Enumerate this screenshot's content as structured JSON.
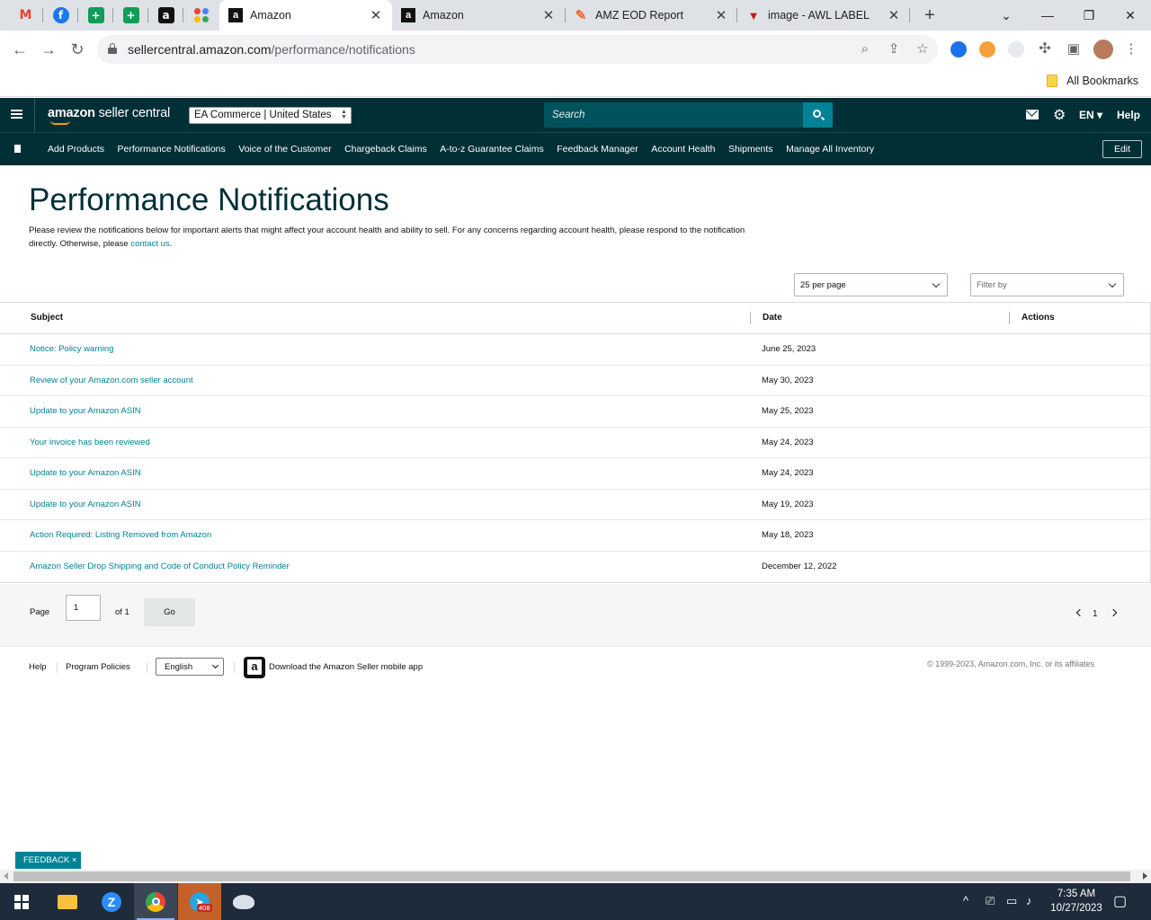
{
  "browser": {
    "pinned_tabs": [
      {
        "icon": "gmail-icon",
        "glyph": "M",
        "color": "#ea4335"
      },
      {
        "icon": "facebook-icon",
        "glyph": "f",
        "color": "#1877f2"
      },
      {
        "icon": "sheets-icon",
        "glyph": "+",
        "color": "#0f9d58"
      },
      {
        "icon": "sheets-icon",
        "glyph": "+",
        "color": "#0f9d58"
      },
      {
        "icon": "amazon-icon",
        "glyph": "a",
        "color": "#111111"
      },
      {
        "icon": "apps-icon",
        "glyph": "::",
        "color": "#f4b400"
      }
    ],
    "tabs": [
      {
        "title": "Amazon",
        "active": true
      },
      {
        "title": "Amazon",
        "active": false
      },
      {
        "title": "AMZ EOD Report",
        "active": false
      },
      {
        "title": "image - AWL LABEL",
        "active": false
      }
    ],
    "url_host": "sellercentral.amazon.com",
    "url_path": "/performance/notifications",
    "bookmarks_label": "All Bookmarks"
  },
  "header": {
    "logo_brand": "amazon",
    "logo_suffix": " seller central",
    "account": "EA Commerce | United States",
    "search_placeholder": "Search",
    "language": "EN",
    "help": "Help"
  },
  "nav": {
    "items": [
      "Add Products",
      "Performance Notifications",
      "Voice of the Customer",
      "Chargeback Claims",
      "A-to-z Guarantee Claims",
      "Feedback Manager",
      "Account Health",
      "Shipments",
      "Manage All Inventory"
    ],
    "edit": "Edit"
  },
  "main": {
    "title": "Performance Notifications",
    "description": "Please review the notifications below for important alerts that might affect your account health and ability to sell. For any concerns regarding account health, please respond to the notification directly. Otherwise, please ",
    "contact_link": "contact us",
    "description_end": ".",
    "per_page": "25 per page",
    "filter": "Filter by",
    "columns": {
      "subject": "Subject",
      "date": "Date",
      "actions": "Actions"
    },
    "rows": [
      {
        "subject": "Notice: Policy warning",
        "date": "June 25, 2023"
      },
      {
        "subject": "Review of your Amazon.com seller account",
        "date": "May 30, 2023"
      },
      {
        "subject": "Update to your Amazon ASIN",
        "date": "May 25, 2023"
      },
      {
        "subject": "Your invoice has been reviewed",
        "date": "May 24, 2023"
      },
      {
        "subject": "Update to your Amazon ASIN",
        "date": "May 24, 2023"
      },
      {
        "subject": "Update to your Amazon ASIN",
        "date": "May 19, 2023"
      },
      {
        "subject": "Action Required: Listing Removed from Amazon",
        "date": "May 18, 2023"
      },
      {
        "subject": "Amazon Seller Drop Shipping and Code of Conduct Policy Reminder",
        "date": "December 12, 2022"
      }
    ],
    "pager": {
      "page_label": "Page",
      "page_value": "1",
      "of_label": "of 1",
      "go": "Go",
      "current": "1"
    }
  },
  "footer": {
    "help": "Help",
    "policies": "Program Policies",
    "language": "English",
    "app_text": "Download the Amazon Seller mobile app",
    "copyright": "© 1999-2023, Amazon.com, Inc. or its affiliates"
  },
  "feedback": "FEEDBACK ×",
  "taskbar": {
    "time": "7:35 AM",
    "date": "10/27/2023",
    "telegram_badge": "408"
  }
}
